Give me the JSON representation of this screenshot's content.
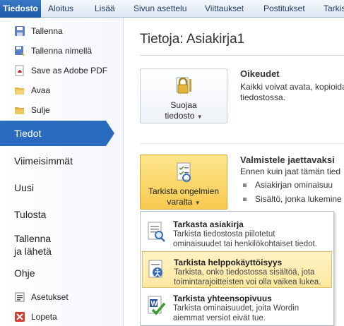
{
  "ribbon": {
    "tabs": [
      {
        "label": "Tiedosto"
      },
      {
        "label": "Aloitus"
      },
      {
        "label": "Lisää"
      },
      {
        "label": "Sivun asettelu"
      },
      {
        "label": "Viittaukset"
      },
      {
        "label": "Postitukset"
      },
      {
        "label": "Tarkis"
      }
    ]
  },
  "sidebar": {
    "commands": [
      {
        "label": "Tallenna",
        "icon": "save-icon"
      },
      {
        "label": "Tallenna nimellä",
        "icon": "save-as-icon"
      },
      {
        "label": "Save as Adobe PDF",
        "icon": "pdf-icon"
      },
      {
        "label": "Avaa",
        "icon": "open-folder-icon"
      },
      {
        "label": "Sulje",
        "icon": "close-folder-icon"
      }
    ],
    "items": [
      {
        "label": "Tiedot"
      },
      {
        "label": "Viimeisimmät"
      },
      {
        "label": "Uusi"
      },
      {
        "label": "Tulosta"
      },
      {
        "label": "Tallenna\nja lähetä"
      },
      {
        "label": "Ohje"
      }
    ],
    "bottom": [
      {
        "label": "Asetukset",
        "icon": "options-icon"
      },
      {
        "label": "Lopeta",
        "icon": "exit-icon"
      }
    ]
  },
  "main": {
    "title": "Tietoja: Asiakirja1",
    "protect": {
      "button_line1": "Suojaa",
      "button_line2": "tiedosto",
      "heading": "Oikeudet",
      "text_line1": "Kaikki voivat avata, kopioida",
      "text_line2": "tiedostossa."
    },
    "prepare": {
      "button_line1": "Tarkista ongelmien",
      "button_line2": "varalta",
      "heading": "Valmistele jaettavaksi",
      "text_line1": "Ennen kuin jaat tämän tied",
      "bullets": [
        "Asiakirjan ominaisuu",
        "Sisältö, jonka lukemine"
      ]
    }
  },
  "dropdown": {
    "items": [
      {
        "title": "Tarkasta asiakirja",
        "desc1": "Tarkista tiedostosta piilotetut",
        "desc2": "ominaisuudet tai henkilökohtaiset tiedot.",
        "icon": "inspect-document-icon"
      },
      {
        "title": "Tarkista helppokäyttöisyys",
        "desc1": "Tarkista, onko tiedostossa sisältöä, jota",
        "desc2": "toimintarajoitteisten voi olla vaikea lukea.",
        "icon": "accessibility-icon"
      },
      {
        "title": "Tarkista yhteensopivuus",
        "desc1": "Tarkista ominaisuudet, joita Wordin",
        "desc2": "aiemmat versiot eivät tue.",
        "icon": "compatibility-icon"
      }
    ]
  },
  "colors": {
    "accent": "#2a6bbf",
    "highlight": "#fde8a0"
  }
}
